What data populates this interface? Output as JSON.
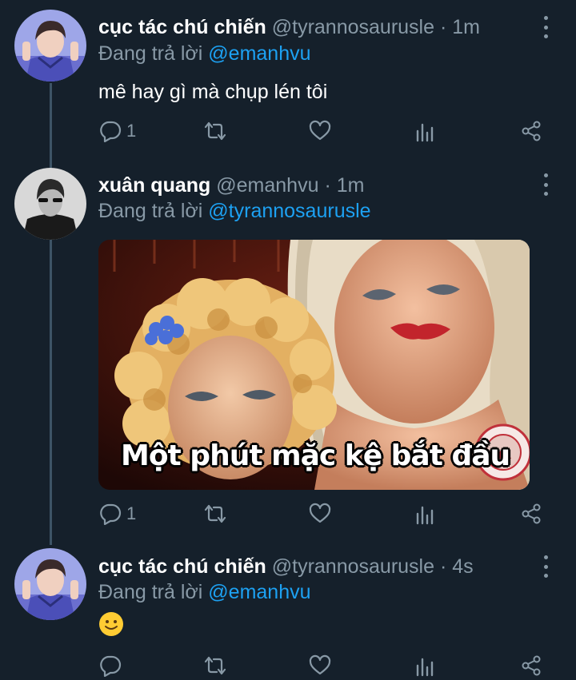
{
  "tweets": [
    {
      "name": "cục tác chú chiến",
      "handle": "@tyrannosaurusle",
      "dot": "·",
      "time": "1m",
      "replying_prefix": "Đang trả lời",
      "replying_to": "@emanhvu",
      "text": "mê hay gì mà chụp lén tôi",
      "reply_count": "1",
      "avatar_icon": "avatar-user-purple"
    },
    {
      "name": "xuân quang",
      "handle": "@emanhvu",
      "dot": "·",
      "time": "1m",
      "replying_prefix": "Đang trả lời",
      "replying_to": "@tyrannosaurusle",
      "media_caption": "Một phút mặc kệ bắt đầu",
      "watermark_text": "HOCVIEN-BICH-NU",
      "reply_count": "1",
      "avatar_icon": "avatar-user-monochrome"
    },
    {
      "name": "cục tác chú chiến",
      "handle": "@tyrannosaurusle",
      "dot": "·",
      "time": "4s",
      "replying_prefix": "Đang trả lời",
      "replying_to": "@emanhvu",
      "emoji": "slightly-smiling-face",
      "reply_count": "",
      "avatar_icon": "avatar-user-purple"
    }
  ],
  "colors": {
    "background": "#15202b",
    "muted": "#8899a6",
    "accent": "#1da1f2",
    "thread_line": "#3d5466"
  },
  "icons": [
    "reply-icon",
    "retweet-icon",
    "like-icon",
    "analytics-icon",
    "share-icon",
    "more-icon"
  ]
}
